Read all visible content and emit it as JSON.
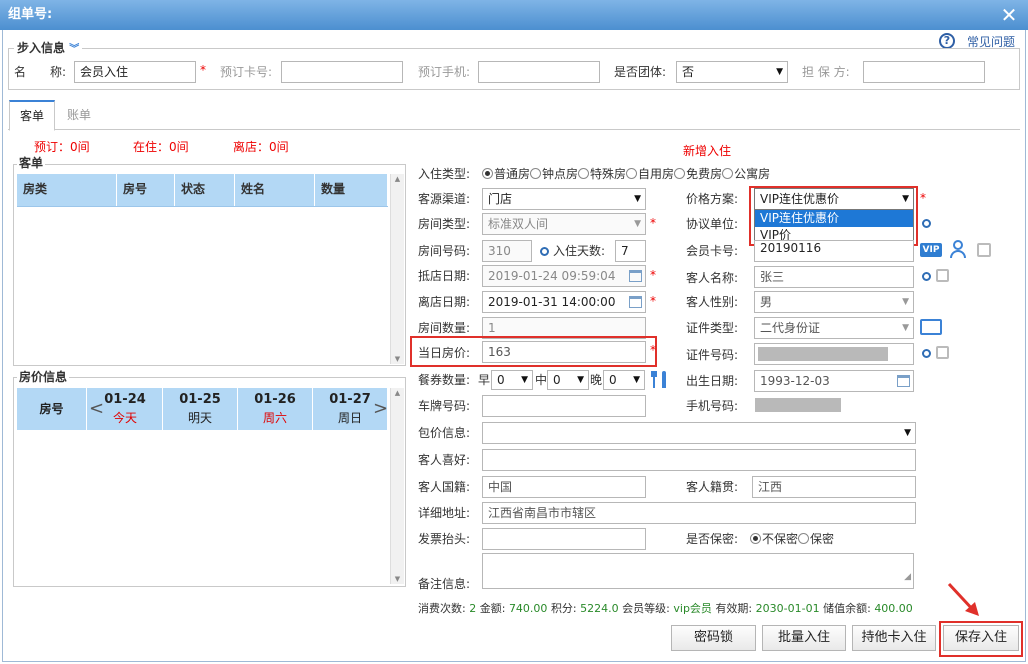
{
  "window": {
    "title": "组单号:"
  },
  "faq": {
    "label": "常见问题"
  },
  "step": {
    "legend": "步入信息",
    "name_label": "名　　称:",
    "name_value": "会员入住",
    "card_label": "预订卡号:",
    "phone_label": "预订手机:",
    "group_label": "是否团体:",
    "group_value": "否",
    "guarantor_label": "担 保 方:"
  },
  "tabs": [
    {
      "label": "客单"
    },
    {
      "label": "账单"
    }
  ],
  "summary": {
    "reserved": "预订：0间",
    "in": "在住：0间",
    "out": "离店：0间"
  },
  "order": {
    "legend": "客单",
    "columns": [
      "房类",
      "房号",
      "状态",
      "姓名",
      "数量"
    ]
  },
  "price": {
    "legend": "房价信息",
    "room_col": "房号",
    "days": [
      {
        "date": "01-24",
        "day": "今天",
        "day_color": "#e00000"
      },
      {
        "date": "01-25",
        "day": "明天",
        "day_color": "#222222"
      },
      {
        "date": "01-26",
        "day": "周六",
        "day_color": "#e00000"
      },
      {
        "date": "01-27",
        "day": "周日",
        "day_color": "#222222"
      }
    ]
  },
  "form": {
    "new_checkin": "新增入住",
    "checkin_type_label": "入住类型:",
    "checkin_types": [
      "普通房",
      "钟点房",
      "特殊房",
      "自用房",
      "免费房",
      "公寓房"
    ],
    "source_label": "客源渠道:",
    "source_value": "门店",
    "price_plan_label": "价格方案:",
    "price_plan_value": "VIP连住优惠价",
    "price_plan_options": [
      "VIP连住优惠价",
      "VIP价"
    ],
    "room_type_label": "房间类型:",
    "room_type_value": "标准双人间",
    "agreement_label": "协议单位:",
    "room_no_label": "房间号码:",
    "room_no_value": "310",
    "days_label": "入住天数:",
    "days_value": "7",
    "member_card_label": "会员卡号:",
    "member_card_value": "20190116",
    "arrive_label": "抵店日期:",
    "arrive_value": "2019-01-24 09:59:04",
    "guest_name_label": "客人名称:",
    "guest_name_value": "张三",
    "leave_label": "离店日期:",
    "leave_value": "2019-01-31 14:00:00",
    "gender_label": "客人性别:",
    "gender_value": "男",
    "room_count_label": "房间数量:",
    "room_count_value": "1",
    "id_type_label": "证件类型:",
    "id_type_value": "二代身份证",
    "day_price_label": "当日房价:",
    "day_price_value": "163",
    "id_no_label": "证件号码:",
    "meal_label": "餐券数量:",
    "breakfast_label": "早",
    "lunch_label": "中",
    "dinner_label": "晚",
    "breakfast_value": "0",
    "lunch_value": "0",
    "dinner_value": "0",
    "birth_label": "出生日期:",
    "birth_value": "1993-12-03",
    "plate_label": "车牌号码:",
    "mobile_label": "手机号码:",
    "package_label": "包价信息:",
    "hobby_label": "客人喜好:",
    "nationality_label": "客人国籍:",
    "nationality_value": "中国",
    "native_label": "客人籍贯:",
    "native_value": "江西",
    "address_label": "详细地址:",
    "address_value": "江西省南昌市市辖区",
    "invoice_label": "发票抬头:",
    "secret_label": "是否保密:",
    "secret_options": [
      "不保密",
      "保密"
    ],
    "remark_label": "备注信息:",
    "vip_badge": "VIP"
  },
  "consume": {
    "count_label": "消费次数:",
    "count": "2",
    "amount_label": "金额:",
    "amount": "740.00",
    "points_label": "积分:",
    "points": "5224.0",
    "level_label": "会员等级:",
    "level": "vip会员",
    "expiry_label": "有效期:",
    "expiry": "2030-01-01",
    "balance_label": "储值余额:",
    "balance": "400.00"
  },
  "buttons": {
    "lock": "密码锁",
    "batch": "批量入住",
    "other_card": "持他卡入住",
    "save": "保存入住"
  }
}
